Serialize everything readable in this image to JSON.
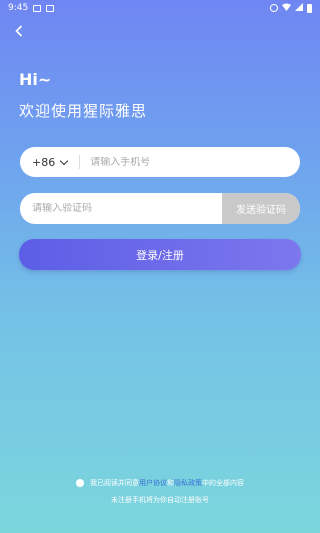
{
  "status": {
    "time": "9:45"
  },
  "back_icon": "back-chevron-icon",
  "greeting": "Hi~",
  "welcome": "欢迎使用猩际雅思",
  "phone": {
    "country_code": "+86",
    "placeholder": "请输入手机号"
  },
  "code": {
    "placeholder": "请输入验证码",
    "send_label": "发送验证码"
  },
  "login_label": "登录/注册",
  "agreement": {
    "prefix": "我已阅读并同意",
    "user_agreement": "用户协议",
    "and": "和",
    "privacy_policy": "隐私政策",
    "suffix": "中的全部内容"
  },
  "hint": "未注册手机将为你自动注册账号",
  "colors": {
    "accent": "#5c5ee6",
    "link": "#3a72d8",
    "disabled": "#c9c9c9"
  }
}
